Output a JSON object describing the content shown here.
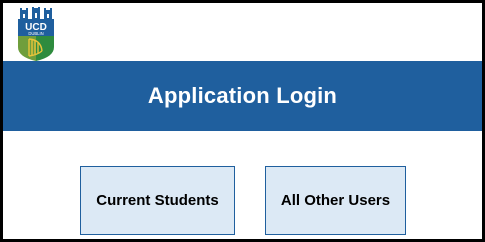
{
  "logo": {
    "name": "ucd-logo",
    "line1": "UCD",
    "line2": "DUBLIN",
    "colors": {
      "blue": "#1f5f9e",
      "green": "#2e8b3e",
      "gold": "#e8c43a"
    }
  },
  "header": {
    "title": "Application Login",
    "background": "#1f5f9e"
  },
  "buttons": {
    "current_students": "Current Students",
    "all_other_users": "All Other Users"
  }
}
